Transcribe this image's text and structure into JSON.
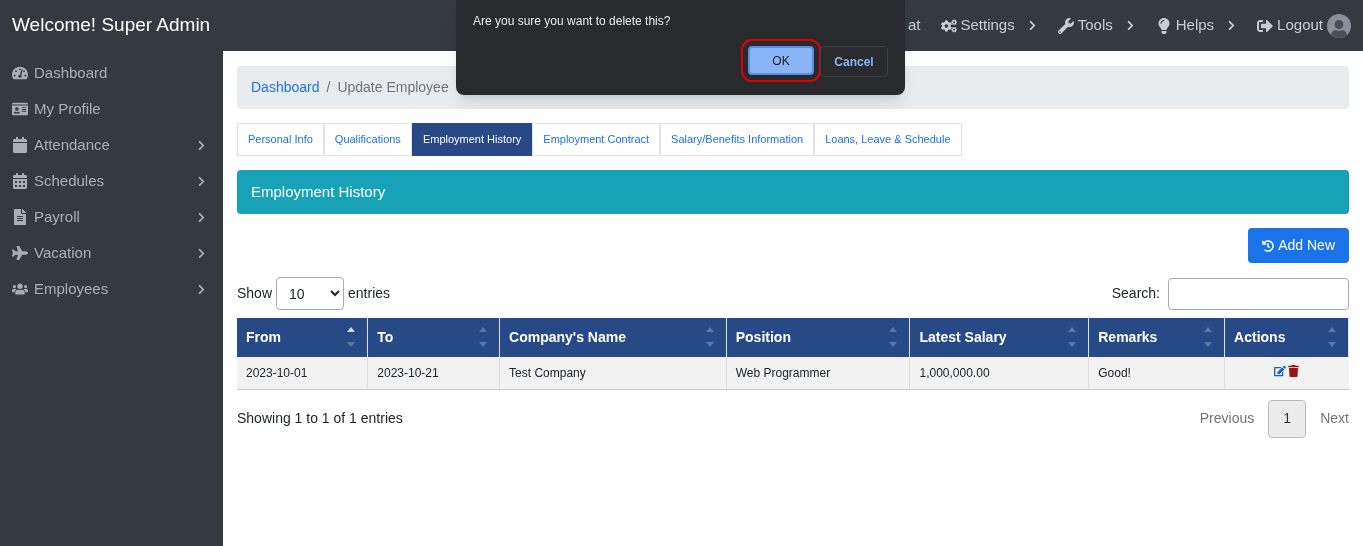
{
  "brand": "Welcome! Super Admin",
  "topnav": [
    {
      "label": "at",
      "chevron": false
    },
    {
      "label": "Settings",
      "chevron": true
    },
    {
      "label": "Tools",
      "chevron": true
    },
    {
      "label": "Helps",
      "chevron": true
    },
    {
      "label": "Logout",
      "chevron": false
    }
  ],
  "sidebar": {
    "items": [
      {
        "label": "Dashboard",
        "chevron": false
      },
      {
        "label": "My Profile",
        "chevron": false
      },
      {
        "label": "Attendance",
        "chevron": true
      },
      {
        "label": "Schedules",
        "chevron": true
      },
      {
        "label": "Payroll",
        "chevron": true
      },
      {
        "label": "Vacation",
        "chevron": true
      },
      {
        "label": "Employees",
        "chevron": true
      }
    ]
  },
  "breadcrumb": {
    "items": [
      "Dashboard",
      "Update Employee"
    ],
    "separator": "/"
  },
  "tabs": [
    {
      "label": "Personal Info",
      "selected": false
    },
    {
      "label": "Qualifications",
      "selected": false
    },
    {
      "label": "Employment History",
      "selected": true
    },
    {
      "label": "Employment Contract",
      "selected": false
    },
    {
      "label": "Salary/Benefits Information",
      "selected": false
    },
    {
      "label": "Loans, Leave & Schedule",
      "selected": false
    }
  ],
  "panel_title": "Employment History",
  "add_button": "Add New",
  "length": {
    "before": "Show",
    "value": "10",
    "after": "entries"
  },
  "search": {
    "label": "Search:"
  },
  "table": {
    "columns": [
      {
        "label": "From",
        "sorted": true
      },
      {
        "label": "To",
        "sorted": false
      },
      {
        "label": "Company's Name",
        "sorted": false
      },
      {
        "label": "Position",
        "sorted": false
      },
      {
        "label": "Latest Salary",
        "sorted": false
      },
      {
        "label": "Remarks",
        "sorted": false
      },
      {
        "label": "Actions",
        "sorted": false
      }
    ],
    "rows": [
      {
        "cells": [
          "2023-10-01",
          "2023-10-21",
          "Test Company",
          "Web Programmer",
          "1,000,000.00",
          "Good!"
        ]
      }
    ]
  },
  "info": "Showing 1 to 1 of 1 entries",
  "pagination": {
    "previous": "Previous",
    "pages": [
      {
        "label": "1",
        "selected": true
      }
    ],
    "next": "Next"
  },
  "dialog": {
    "message": "Are you sure you want to delete this?",
    "ok": "OK",
    "cancel": "Cancel"
  }
}
